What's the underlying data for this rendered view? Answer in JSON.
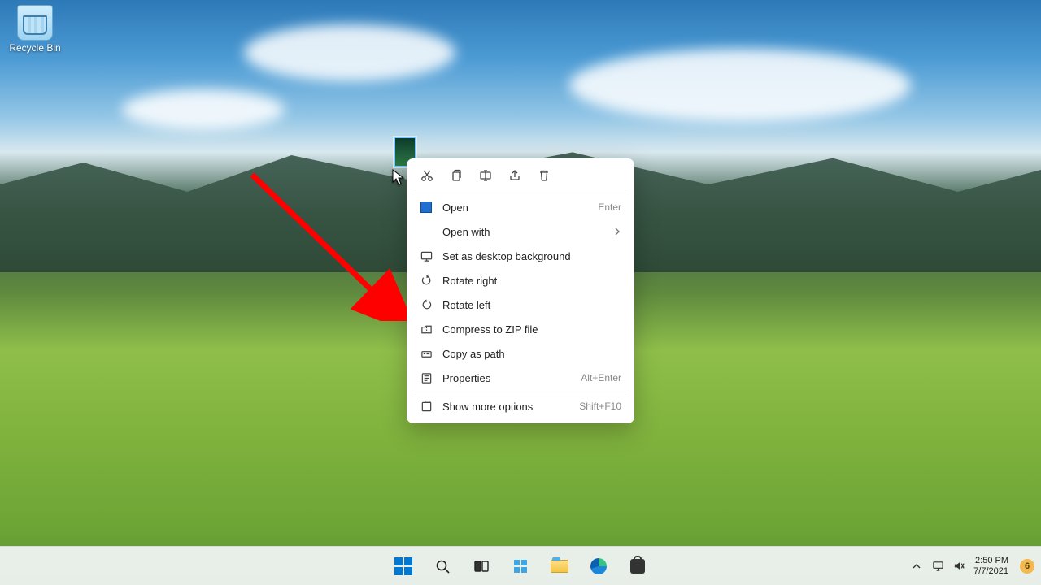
{
  "desktop": {
    "icons": [
      {
        "name": "recycle-bin",
        "label": "Recycle Bin"
      }
    ]
  },
  "context_menu": {
    "toolbar": [
      "cut",
      "copy",
      "rename",
      "share",
      "delete"
    ],
    "items": [
      {
        "id": "open",
        "label": "Open",
        "accel": "Enter",
        "icon": "open"
      },
      {
        "id": "open-with",
        "label": "Open with",
        "submenu": true,
        "icon": ""
      },
      {
        "id": "set-bg",
        "label": "Set as desktop background",
        "icon": "desktop"
      },
      {
        "id": "rotate-right",
        "label": "Rotate right",
        "icon": "rotate-right"
      },
      {
        "id": "rotate-left",
        "label": "Rotate left",
        "icon": "rotate-left"
      },
      {
        "id": "zip",
        "label": "Compress to ZIP file",
        "icon": "zip"
      },
      {
        "id": "copy-path",
        "label": "Copy as path",
        "icon": "copy-path"
      },
      {
        "id": "properties",
        "label": "Properties",
        "accel": "Alt+Enter",
        "icon": "properties"
      },
      {
        "id": "more",
        "label": "Show more options",
        "accel": "Shift+F10",
        "icon": "more"
      }
    ]
  },
  "taskbar": {
    "apps": [
      "start",
      "search",
      "task-view",
      "widgets",
      "explorer",
      "edge",
      "store"
    ],
    "tray": {
      "chevron": "▲",
      "time": "2:50 PM",
      "date": "7/7/2021",
      "notif_count": "6"
    }
  }
}
